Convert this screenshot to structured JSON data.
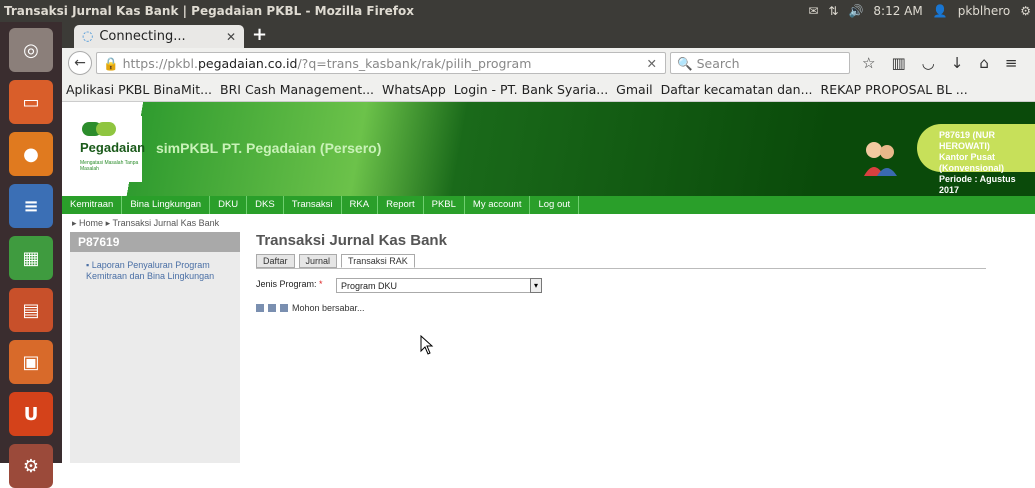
{
  "os": {
    "window_title": "Transaksi Jurnal Kas Bank | Pegadaian PKBL - Mozilla Firefox",
    "time": "8:12 AM",
    "user": "pkblhero",
    "tray_icons": [
      "mail-icon",
      "network-icon",
      "volume-icon",
      "user-icon",
      "settings-icon"
    ]
  },
  "browser": {
    "tab_title": "Connecting...",
    "url_prefix": "https://pkbl.",
    "url_domain": "pegadaian.co.id",
    "url_path": "/?q=trans_kasbank/rak/pilih_program",
    "search_placeholder": "Search",
    "bookmarks": [
      "Aplikasi PKBL BinaMit...",
      "BRI Cash Management...",
      "WhatsApp",
      "Login - PT. Bank Syaria...",
      "Gmail",
      "Daftar kecamatan dan...",
      "REKAP PROPOSAL BL ..."
    ]
  },
  "site": {
    "logo_text": "Pegadaian",
    "logo_sub": "Mengatasi Masalah Tanpa Masalah",
    "app_name": "simPKBL PT. Pegadaian (Persero)",
    "user_lines": [
      "P87619 (NUR HEROWATI)",
      "Kantor Pusat (Konvensional)",
      "Periode : Agustus 2017"
    ],
    "menu": [
      "Kemitraan",
      "Bina Lingkungan",
      "DKU",
      "DKS",
      "Transaksi",
      "RKA",
      "Report",
      "PKBL",
      "My account",
      "Log out"
    ],
    "breadcrumb": [
      "Home",
      "Transaksi Jurnal Kas Bank"
    ],
    "sidebar_header": "P87619",
    "sidebar_link": "Laporan Penyaluran Program Kemitraan dan Bina Lingkungan",
    "page_title": "Transaksi Jurnal Kas Bank",
    "tabs": [
      "Daftar",
      "Jurnal",
      "Transaksi RAK"
    ],
    "field_label": "Jenis Program:",
    "field_required": "*",
    "field_value": "Program DKU",
    "loading_text": "Mohon bersabar..."
  }
}
